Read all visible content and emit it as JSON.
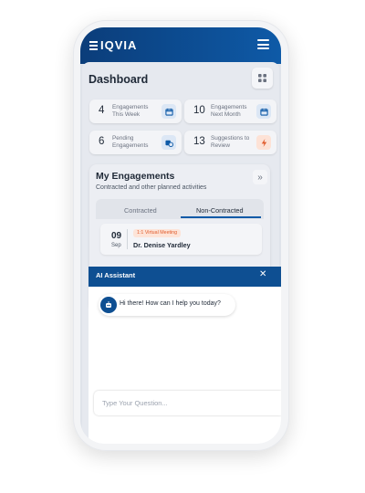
{
  "header": {
    "brand": "IQVIA"
  },
  "dashboard": {
    "title": "Dashboard",
    "cards": [
      {
        "number": "4",
        "label": "Engagements This Week",
        "icon": "calendar-icon"
      },
      {
        "number": "10",
        "label": "Engagements Next Month",
        "icon": "calendar-icon"
      },
      {
        "number": "6",
        "label": "Pending Engagements",
        "icon": "calendar-pending-icon"
      },
      {
        "number": "13",
        "label": "Suggestions to Review",
        "icon": "lightning-icon"
      }
    ]
  },
  "engagements": {
    "title": "My Engagements",
    "subtitle": "Contracted and other planned activities",
    "tabs": [
      "Contracted",
      "Non-Contracted"
    ],
    "active_tab": "Non-Contracted",
    "items": [
      {
        "day": "09",
        "month": "Sep",
        "type": "1:1 Virtual Meeting",
        "name": "Dr. Denise Yardley"
      }
    ]
  },
  "assistant": {
    "title": "AI Assistant",
    "message": "Hi there! How can I help you today?",
    "input_placeholder": "Type Your Question..."
  },
  "colors": {
    "brand": "#0e5aa7",
    "accent_orange": "#e05a2b",
    "background": "#e6e9ef"
  }
}
